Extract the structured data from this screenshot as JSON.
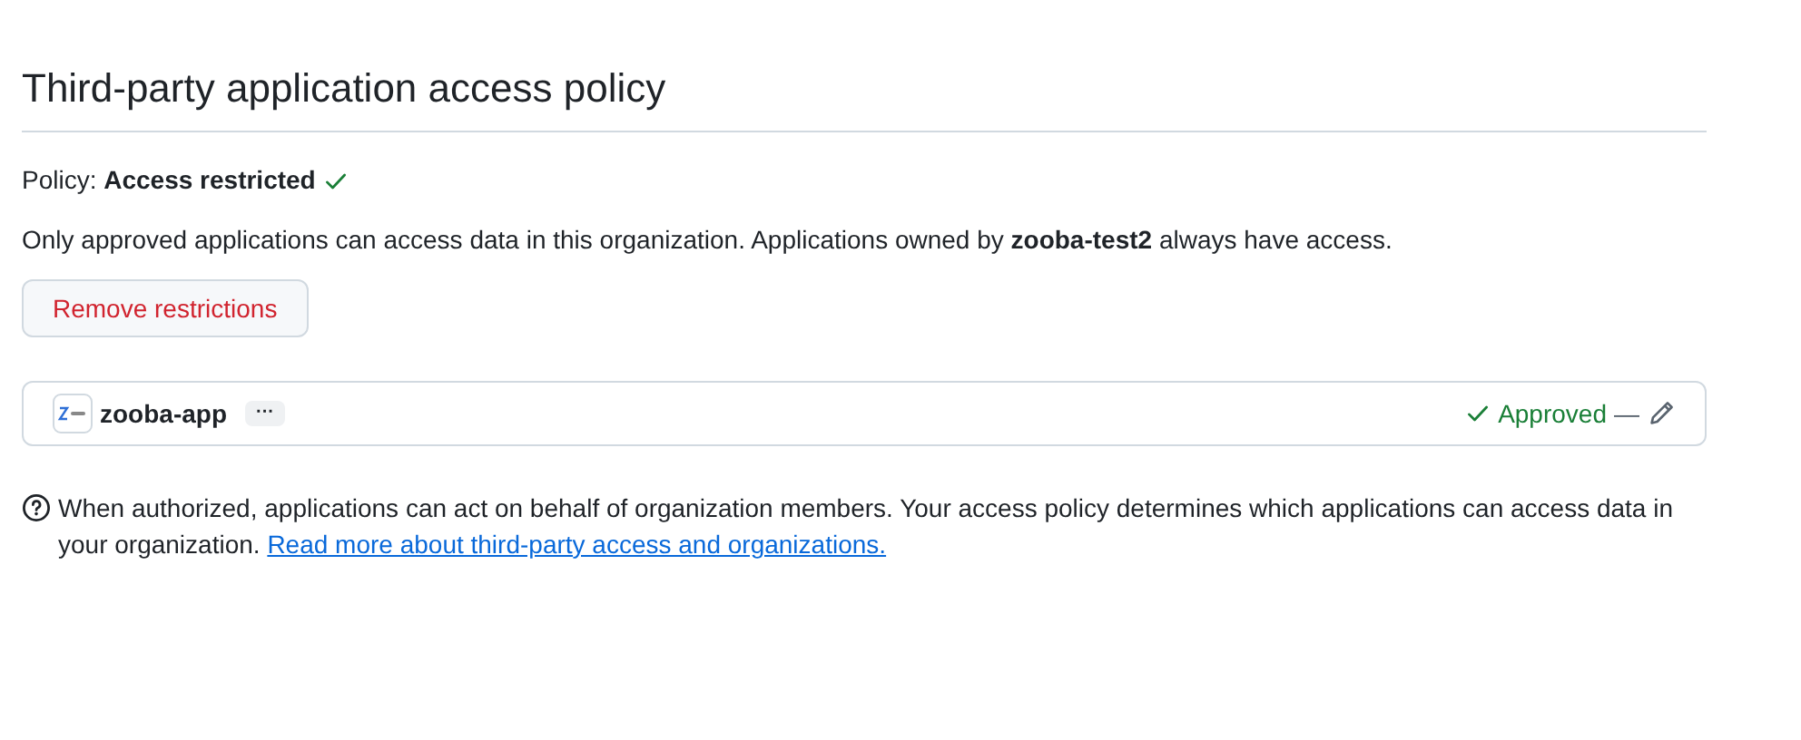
{
  "heading": "Third-party application access policy",
  "policy": {
    "label": "Policy: **Access restricted**",
    "approved": true
  },
  "description": "Only approved applications can access data in this organization. Applications owned by **zooba-test2** always have access.",
  "remove_button": "Remove restrictions",
  "applications": [
    {
      "name": "zooba-app",
      "more": "···",
      "status": "Approved",
      "approved": true,
      "separator": "—"
    }
  ],
  "help": {
    "text": "When authorized, applications can act on behalf of organization members. Your access policy determines which applications can access data in your organization.",
    "link": "Read more about third-party access and organizations."
  }
}
